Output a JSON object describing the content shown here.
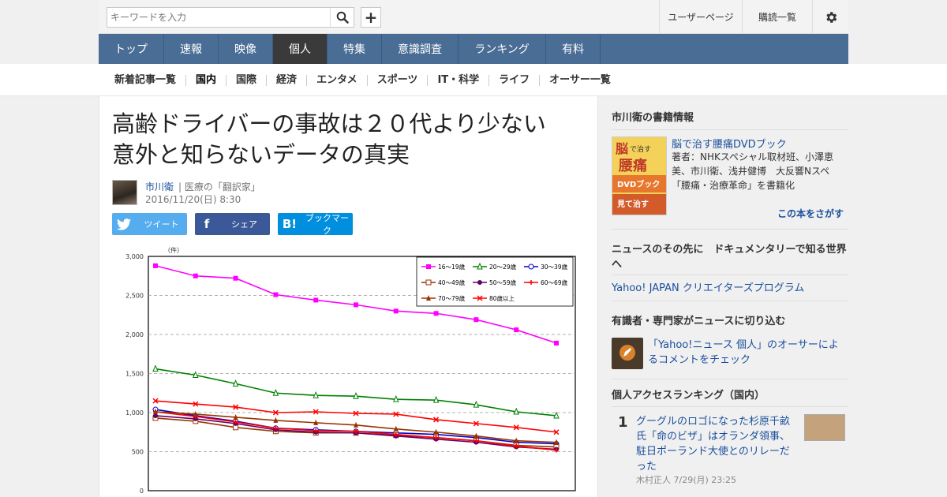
{
  "search": {
    "placeholder": "キーワードを入力"
  },
  "header": {
    "user_page": "ユーザーページ",
    "subscriptions": "購読一覧"
  },
  "main_nav": [
    {
      "label": "トップ",
      "active": false
    },
    {
      "label": "速報",
      "active": false
    },
    {
      "label": "映像",
      "active": false
    },
    {
      "label": "個人",
      "active": true
    },
    {
      "label": "特集",
      "active": false
    },
    {
      "label": "意識調査",
      "active": false
    },
    {
      "label": "ランキング",
      "active": false
    },
    {
      "label": "有料",
      "active": false
    }
  ],
  "sub_nav": [
    {
      "label": "新着記事一覧",
      "active": false
    },
    {
      "label": "国内",
      "active": true
    },
    {
      "label": "国際",
      "active": false
    },
    {
      "label": "経済",
      "active": false
    },
    {
      "label": "エンタメ",
      "active": false
    },
    {
      "label": "スポーツ",
      "active": false
    },
    {
      "label": "IT・科学",
      "active": false
    },
    {
      "label": "ライフ",
      "active": false
    },
    {
      "label": "オーサー一覧",
      "active": false
    }
  ],
  "article": {
    "title": "高齢ドライバーの事故は２０代より少ない　意外と知らないデータの真実",
    "author": "市川衛",
    "author_role": "| 医療の「翻訳家」",
    "date": "2016/11/20(日) 8:30"
  },
  "share": {
    "tweet": "ツイート",
    "facebook": "シェア",
    "hatena": "ブックマーク"
  },
  "sidebar": {
    "book_heading": "市川衛の書籍情報",
    "book_title": "脳で治す腰痛DVDブック",
    "book_desc": "著者：NHKスペシャル取材班、小澤恵美、市川衛、浅井健博　大反響Nスペ「腰痛・治療革命」を書籍化",
    "book_find": "この本をさがす",
    "doc_heading": "ニュースのその先に　ドキュメンタリーで知る世界へ",
    "doc_link": "Yahoo! JAPAN クリエイターズプログラム",
    "expert_heading": "有識者・専門家がニュースに切り込む",
    "expert_text": "「Yahoo!ニュース 個人」のオーサーによるコメントをチェック",
    "ranking_heading": "個人アクセスランキング（国内）",
    "ranking": [
      {
        "rank": "1",
        "title": "グーグルのロゴになった杉原千畝氏「命のビザ」はオランダ領事、駐日ポーランド大使とのリレーだった",
        "meta": "木村正人 7/29(月) 23:25"
      }
    ]
  },
  "colors": {
    "nav_bg": "#4a6d95",
    "nav_active": "#3a3a3a",
    "link": "#1a4f9c"
  },
  "chart_data": {
    "type": "line",
    "unit_label": "（件）",
    "ylim": [
      0,
      3000
    ],
    "yticks": [
      "0",
      "500",
      "1,000",
      "1,500",
      "2,000",
      "2,500",
      "3,000"
    ],
    "grid": true,
    "legend_position": "top-right",
    "series": [
      {
        "name": "16～19歳",
        "color": "#ff00ff",
        "marker": "square",
        "values": [
          2880,
          2750,
          2720,
          2510,
          2440,
          2380,
          2300,
          2270,
          2190,
          2060,
          1890
        ]
      },
      {
        "name": "20～29歳",
        "color": "#008000",
        "marker": "triangle-open",
        "values": [
          1560,
          1480,
          1370,
          1250,
          1220,
          1210,
          1170,
          1160,
          1100,
          1010,
          960
        ]
      },
      {
        "name": "30～39歳",
        "color": "#0000cc",
        "marker": "circle-open",
        "values": [
          1040,
          960,
          890,
          800,
          780,
          760,
          740,
          720,
          680,
          620,
          600
        ]
      },
      {
        "name": "40～49歳",
        "color": "#993300",
        "marker": "square-open",
        "values": [
          930,
          890,
          810,
          760,
          740,
          740,
          710,
          680,
          640,
          580,
          560
        ]
      },
      {
        "name": "50～59歳",
        "color": "#660066",
        "marker": "circle",
        "values": [
          960,
          920,
          860,
          780,
          750,
          740,
          700,
          660,
          620,
          560,
          530
        ]
      },
      {
        "name": "60～69歳",
        "color": "#ff0000",
        "marker": "plus",
        "values": [
          1010,
          950,
          880,
          800,
          770,
          760,
          720,
          680,
          640,
          570,
          520
        ]
      },
      {
        "name": "70～79歳",
        "color": "#993300",
        "marker": "triangle",
        "values": [
          1010,
          980,
          940,
          900,
          870,
          840,
          790,
          750,
          700,
          640,
          620
        ]
      },
      {
        "name": "80歳以上",
        "color": "#ff0000",
        "marker": "x",
        "values": [
          1150,
          1110,
          1070,
          1000,
          1010,
          990,
          980,
          910,
          860,
          810,
          750
        ]
      }
    ]
  }
}
